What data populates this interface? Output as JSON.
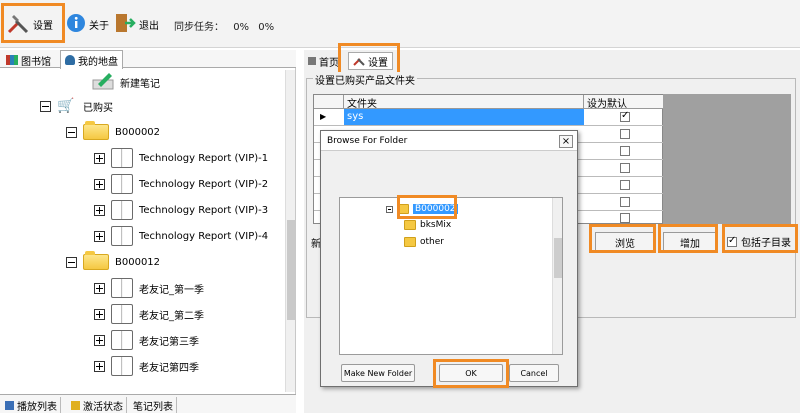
{
  "toolbar": {
    "settings_label": "设置",
    "about_label": "关于",
    "exit_label": "退出",
    "sync_label": "同步任务：",
    "sync_value1": "0%",
    "sync_value2": "0%"
  },
  "left_tabs": {
    "library": "图书馆",
    "my_shelf": "我的地盘"
  },
  "tree": {
    "new_note": "新建笔记",
    "purchased": "已购买",
    "folder1": "B000002",
    "folder1_items": [
      "Technology Report (VIP)-1",
      "Technology Report (VIP)-2",
      "Technology Report (VIP)-3",
      "Technology Report (VIP)-4"
    ],
    "folder2": "B000012",
    "folder2_items": [
      "老友记_第一季",
      "老友记_第二季",
      "老友记第三季",
      "老友记第四季"
    ]
  },
  "bottom_tabs": {
    "playlist": "播放列表",
    "activation": "激活状态",
    "notes": "笔记列表"
  },
  "right": {
    "tab_home": "首页",
    "tab_settings": "设置",
    "group_title": "设置已购买产品文件夹",
    "col_folder": "文件夹",
    "col_default": "设为默认",
    "row1_folder": "sys",
    "partial_label": "新",
    "browse_button": "浏览",
    "add_button": "增加",
    "include_subdir": "包括子目录"
  },
  "dialog": {
    "title": "Browse For Folder",
    "close": "×",
    "tree_items": [
      "B000002",
      "bksMix",
      "other"
    ],
    "make_new_folder": "Make New Folder",
    "ok": "OK",
    "cancel": "Cancel"
  },
  "colors": {
    "highlight": "#f08a24",
    "selection": "#3399ff"
  }
}
